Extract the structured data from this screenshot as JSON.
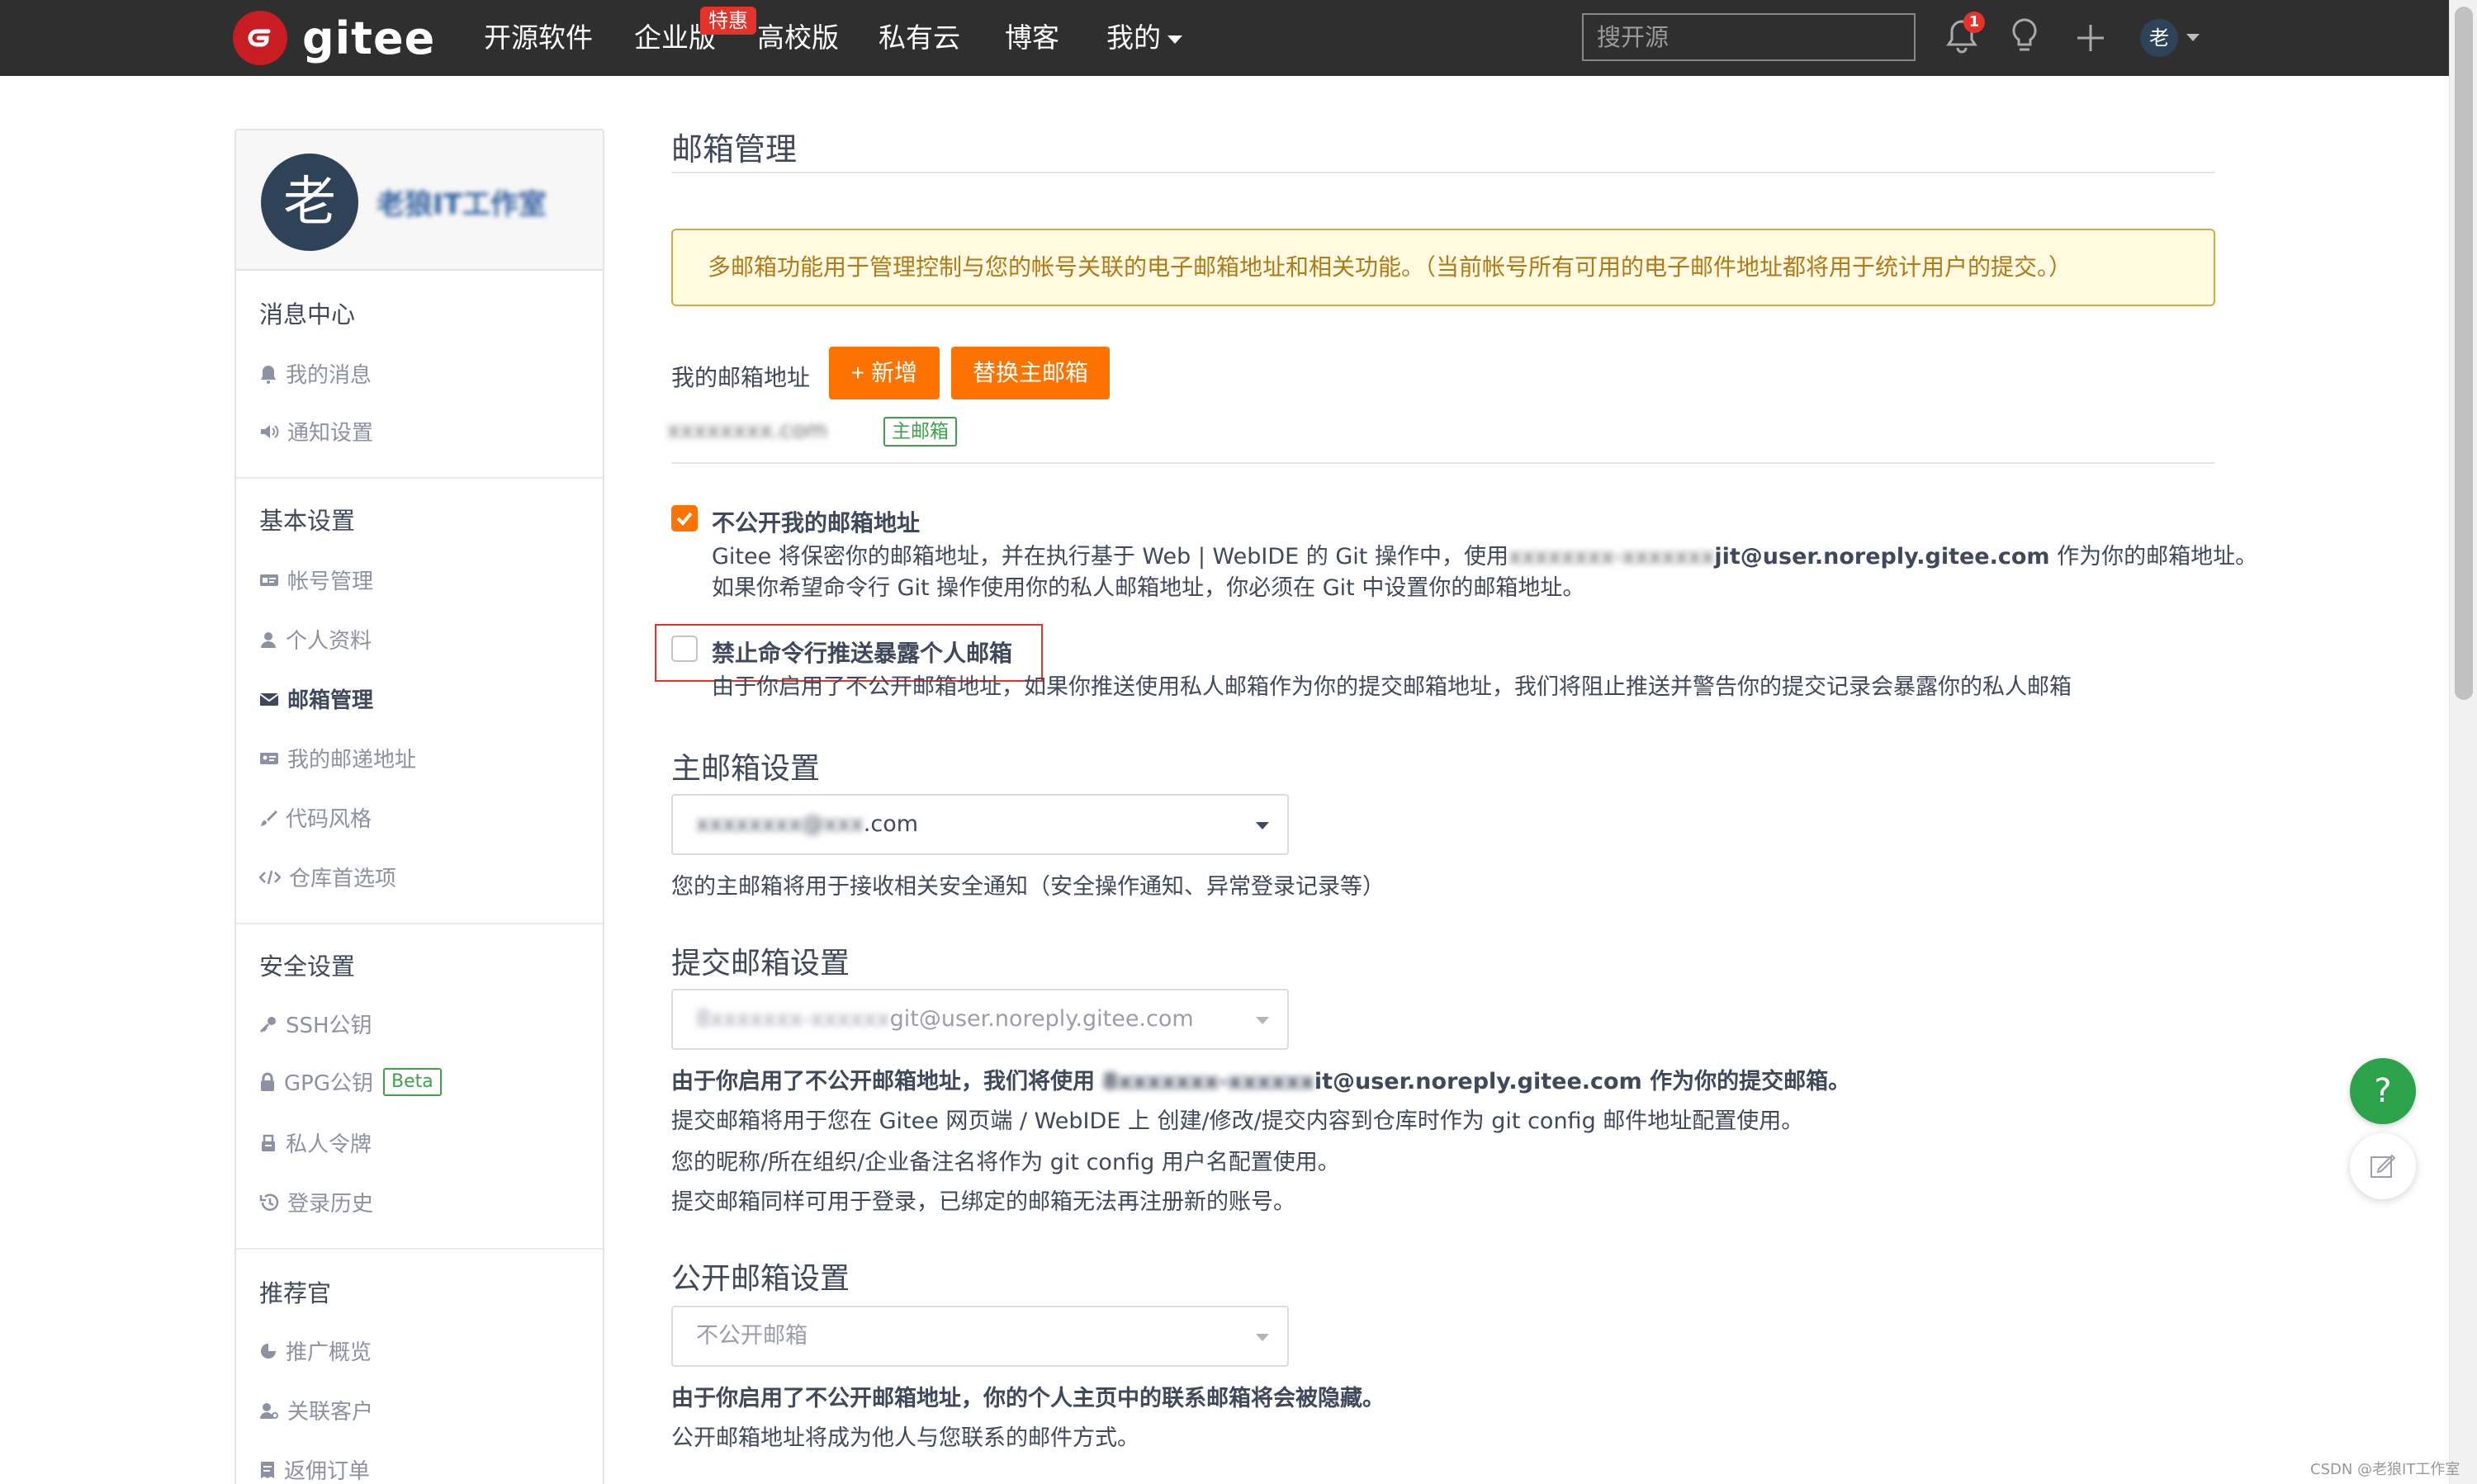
{
  "navbar": {
    "logo_text": "gitee",
    "logo_letter": "G",
    "items": [
      "开源软件",
      "企业版",
      "高校版",
      "私有云",
      "博客",
      "我的"
    ],
    "enterprise_badge": "特惠",
    "search_placeholder": "搜开源",
    "notification_count": "1",
    "avatar_letter": "老"
  },
  "sidebar": {
    "avatar_letter": "老",
    "username": "老狼IT工作室",
    "sections": [
      {
        "title": "消息中心",
        "items": [
          {
            "label": "我的消息",
            "icon": "bell-icon"
          },
          {
            "label": "通知设置",
            "icon": "volume-icon"
          }
        ]
      },
      {
        "title": "基本设置",
        "items": [
          {
            "label": "帐号管理",
            "icon": "id-card-icon"
          },
          {
            "label": "个人资料",
            "icon": "user-icon"
          },
          {
            "label": "邮箱管理",
            "icon": "envelope-icon",
            "active": true
          },
          {
            "label": "我的邮递地址",
            "icon": "address-card-icon"
          },
          {
            "label": "代码风格",
            "icon": "brush-icon"
          },
          {
            "label": "仓库首选项",
            "icon": "code-icon"
          }
        ]
      },
      {
        "title": "安全设置",
        "items": [
          {
            "label": "SSH公钥",
            "icon": "key-icon"
          },
          {
            "label": "GPG公钥",
            "icon": "lock-icon",
            "badge": "Beta"
          },
          {
            "label": "私人令牌",
            "icon": "token-icon"
          },
          {
            "label": "登录历史",
            "icon": "history-icon"
          }
        ]
      },
      {
        "title": "推荐官",
        "items": [
          {
            "label": "推广概览",
            "icon": "chart-icon"
          },
          {
            "label": "关联客户",
            "icon": "user-link-icon"
          },
          {
            "label": "返佣订单",
            "icon": "receipt-icon"
          }
        ]
      }
    ]
  },
  "main": {
    "title": "邮箱管理",
    "notice": "多邮箱功能用于管理控制与您的帐号关联的电子邮箱地址和相关功能。（当前帐号所有可用的电子邮件地址都将用于统计用户的提交。）",
    "my_email_label": "我的邮箱地址",
    "add_button": "+ 新增",
    "replace_button": "替换主邮箱",
    "email_masked": "xxxxxxxx.com",
    "primary_tag": "主邮箱",
    "option1": {
      "checked": true,
      "title": "不公开我的邮箱地址",
      "desc1_prefix": "Gitee 将保密你的邮箱地址，并在执行基于 Web | WebIDE 的 Git 操作中，使用",
      "desc1_mask": "xxxxxxxx-xxxxxxx",
      "desc1_email": "jit@user.noreply.gitee.com",
      "desc1_suffix": " 作为你的邮箱地址。",
      "desc2": "如果你希望命令行 Git 操作使用你的私人邮箱地址，你必须在 Git 中设置你的邮箱地址。"
    },
    "option2": {
      "checked": false,
      "title": "禁止命令行推送暴露个人邮箱",
      "desc": "由于你启用了不公开邮箱地址，如果你推送使用私人邮箱作为你的提交邮箱地址，我们将阻止推送并警告你的提交记录会暴露你的私人邮箱"
    },
    "primary_section": {
      "title": "主邮箱设置",
      "select_mask": "xxxxxxxx@xxx",
      "select_suffix": ".com",
      "hint": "您的主邮箱将用于接收相关安全通知（安全操作通知、异常登录记录等）"
    },
    "commit_section": {
      "title": "提交邮箱设置",
      "select_mask": "8xxxxxxx-xxxxxx",
      "select_suffix": "git@user.noreply.gitee.com",
      "hint_bold_prefix": "由于你启用了不公开邮箱地址，我们将使用 ",
      "hint_bold_mask": "8xxxxxxx-xxxxxx",
      "hint_bold_suffix": "it@user.noreply.gitee.com 作为你的提交邮箱。",
      "hint2": "提交邮箱将用于您在 Gitee 网页端 / WebIDE 上 创建/修改/提交内容到仓库时作为 git config 邮件地址配置使用。",
      "hint3": "您的昵称/所在组织/企业备注名将作为 git config 用户名配置使用。",
      "hint4": "提交邮箱同样可用于登录，已绑定的邮箱无法再注册新的账号。"
    },
    "public_section": {
      "title": "公开邮箱设置",
      "select_value": "不公开邮箱",
      "hint_bold": "由于你启用了不公开邮箱地址，你的个人主页中的联系邮箱将会被隐藏。",
      "hint2": "公开邮箱地址将成为他人与您联系的邮件方式。"
    }
  },
  "floating": {
    "help": "?"
  },
  "watermark": "CSDN @老狼IT工作室",
  "colors": {
    "brand": "#c71d23",
    "accent": "#fe7300",
    "navbar": "#2f2f2f",
    "success": "#3fa14c"
  }
}
